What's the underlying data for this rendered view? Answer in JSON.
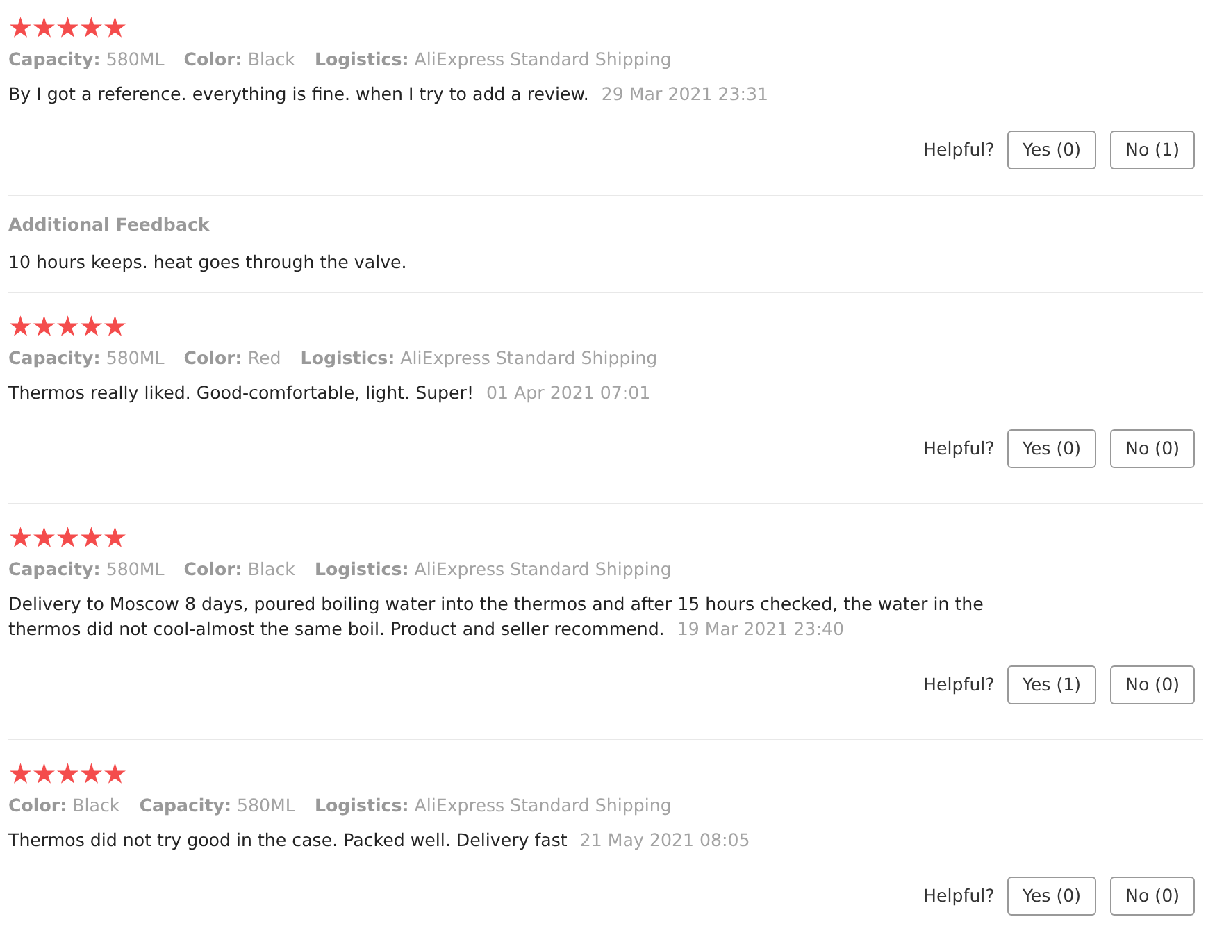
{
  "reviews": [
    {
      "stars": 5,
      "attributes": [
        {
          "label": "Capacity:",
          "value": "580ML"
        },
        {
          "label": "Color:",
          "value": "Black"
        },
        {
          "label": "Logistics:",
          "value": "AliExpress Standard Shipping"
        }
      ],
      "text_lines": [
        "By I got a reference. everything is fine. when I try to add a review."
      ],
      "date": "29 Mar 2021 23:31",
      "helpful_label": "Helpful?",
      "buttons": [
        "Yes (0)",
        "No (1)"
      ],
      "additional_feedback": {
        "title": "Additional Feedback",
        "text": "10 hours keeps. heat goes through the valve."
      }
    },
    {
      "stars": 5,
      "attributes": [
        {
          "label": "Capacity:",
          "value": "580ML"
        },
        {
          "label": "Color:",
          "value": "Red"
        },
        {
          "label": "Logistics:",
          "value": "AliExpress Standard Shipping"
        }
      ],
      "text_lines": [
        "Thermos really liked. Good-comfortable, light. Super!"
      ],
      "date": "01 Apr 2021 07:01",
      "helpful_label": "Helpful?",
      "buttons": [
        "Yes (0)",
        "No (0)"
      ]
    },
    {
      "stars": 5,
      "attributes": [
        {
          "label": "Capacity:",
          "value": "580ML"
        },
        {
          "label": "Color:",
          "value": "Black"
        },
        {
          "label": "Logistics:",
          "value": "AliExpress Standard Shipping"
        }
      ],
      "text_lines": [
        "Delivery to Moscow 8 days, poured boiling water into the thermos and after 15 hours checked, the water in the",
        "thermos did not cool-almost the same boil. Product and seller recommend."
      ],
      "date": "19 Mar 2021 23:40",
      "helpful_label": "Helpful?",
      "buttons": [
        "Yes (1)",
        "No (0)"
      ]
    },
    {
      "stars": 5,
      "attributes": [
        {
          "label": "Color:",
          "value": "Black"
        },
        {
          "label": "Capacity:",
          "value": "580ML"
        },
        {
          "label": "Logistics:",
          "value": "AliExpress Standard Shipping"
        }
      ],
      "text_lines": [
        "Thermos did not try good in the case. Packed well. Delivery fast"
      ],
      "date": "21 May 2021 08:05",
      "helpful_label": "Helpful?",
      "buttons": [
        "Yes (0)",
        "No (0)"
      ]
    }
  ]
}
